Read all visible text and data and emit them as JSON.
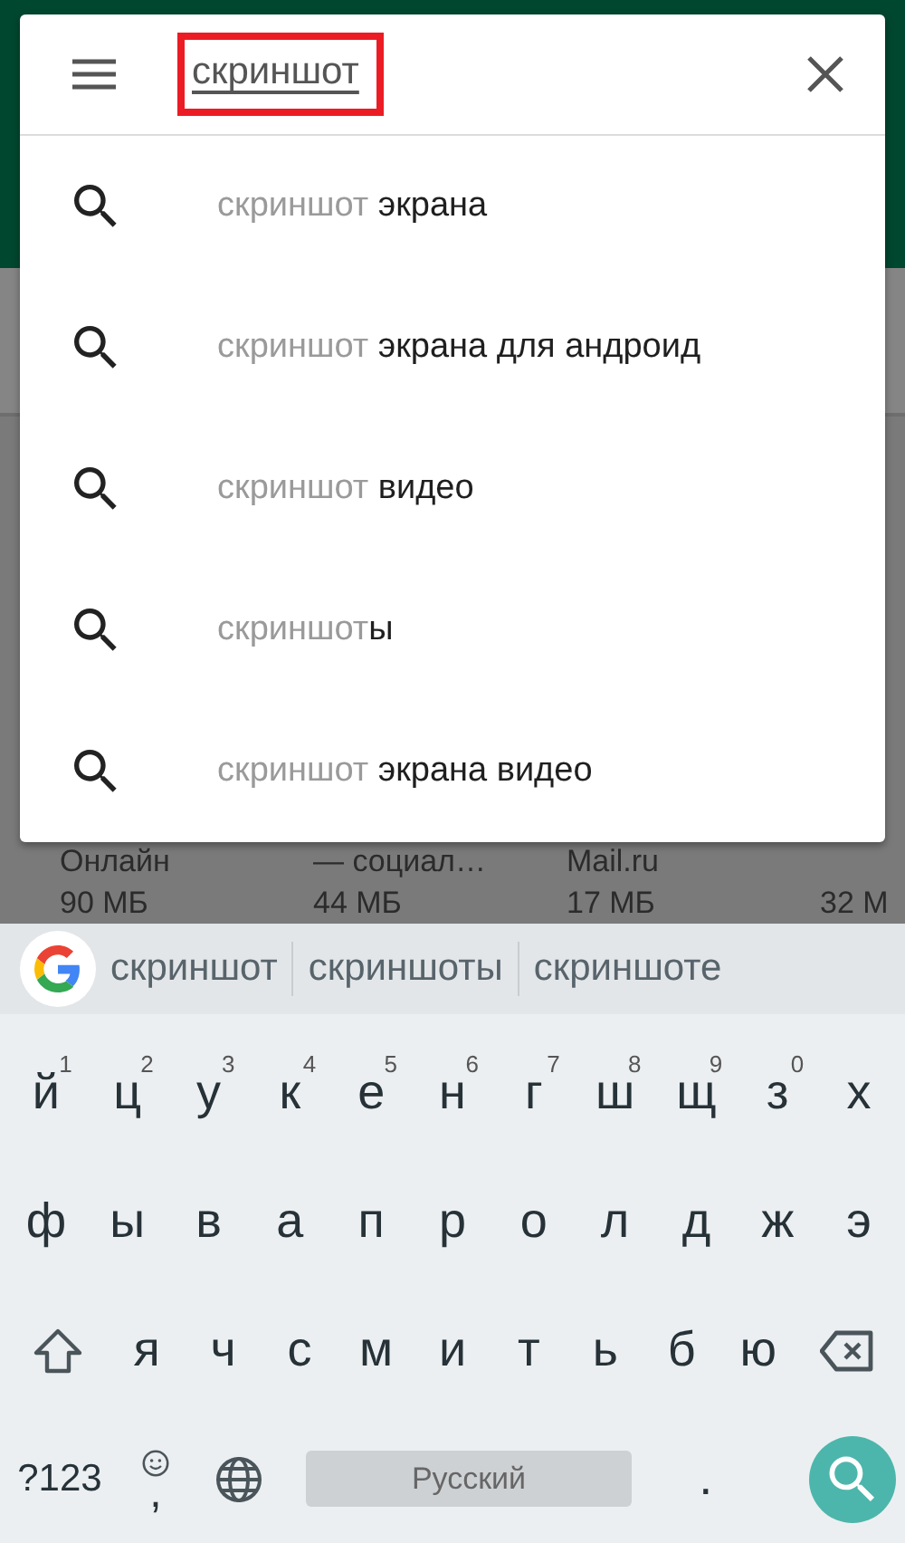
{
  "search": {
    "value": "скриншот",
    "highlighted": true
  },
  "suggestions": [
    {
      "typed": "скриншот",
      "completion": " экрана"
    },
    {
      "typed": "скриншот",
      "completion": " экрана для андроид"
    },
    {
      "typed": "скриншот",
      "completion": " видео"
    },
    {
      "typed": "скриншот",
      "completion": "ы"
    },
    {
      "typed": "скриншот",
      "completion": " экрана видео"
    }
  ],
  "apps": [
    {
      "name": "Онлайн",
      "size": "90 МБ"
    },
    {
      "name": "— социал…",
      "size": "44 МБ"
    },
    {
      "name": "Mail.ru",
      "size": "17 МБ"
    },
    {
      "size": "32 М"
    }
  ],
  "keyboard": {
    "word_suggestions": [
      "скриншот",
      "скриншоты",
      "скриншоте"
    ],
    "rows": [
      {
        "keys": [
          {
            "kind": "letter",
            "label": "й",
            "hint": "1"
          },
          {
            "kind": "letter",
            "label": "ц",
            "hint": "2"
          },
          {
            "kind": "letter",
            "label": "у",
            "hint": "3"
          },
          {
            "kind": "letter",
            "label": "к",
            "hint": "4"
          },
          {
            "kind": "letter",
            "label": "е",
            "hint": "5"
          },
          {
            "kind": "letter",
            "label": "н",
            "hint": "6"
          },
          {
            "kind": "letter",
            "label": "г",
            "hint": "7"
          },
          {
            "kind": "letter",
            "label": "ш",
            "hint": "8"
          },
          {
            "kind": "letter",
            "label": "щ",
            "hint": "9"
          },
          {
            "kind": "letter",
            "label": "з",
            "hint": "0"
          },
          {
            "kind": "letter",
            "label": "х"
          }
        ]
      },
      {
        "keys": [
          {
            "kind": "letter",
            "label": "ф"
          },
          {
            "kind": "letter",
            "label": "ы"
          },
          {
            "kind": "letter",
            "label": "в"
          },
          {
            "kind": "letter",
            "label": "а"
          },
          {
            "kind": "letter",
            "label": "п"
          },
          {
            "kind": "letter",
            "label": "р"
          },
          {
            "kind": "letter",
            "label": "о"
          },
          {
            "kind": "letter",
            "label": "л"
          },
          {
            "kind": "letter",
            "label": "д"
          },
          {
            "kind": "letter",
            "label": "ж"
          },
          {
            "kind": "letter",
            "label": "э"
          }
        ]
      },
      {
        "keys": [
          {
            "kind": "shift"
          },
          {
            "kind": "letter",
            "label": "я"
          },
          {
            "kind": "letter",
            "label": "ч"
          },
          {
            "kind": "letter",
            "label": "с"
          },
          {
            "kind": "letter",
            "label": "м"
          },
          {
            "kind": "letter",
            "label": "и"
          },
          {
            "kind": "letter",
            "label": "т"
          },
          {
            "kind": "letter",
            "label": "ь"
          },
          {
            "kind": "letter",
            "label": "б"
          },
          {
            "kind": "letter",
            "label": "ю"
          },
          {
            "kind": "backspace"
          }
        ]
      },
      {
        "keys": [
          {
            "kind": "symbols",
            "label": "?123"
          },
          {
            "kind": "comma",
            "label": ","
          },
          {
            "kind": "globe"
          },
          {
            "kind": "space",
            "label": "Русский"
          },
          {
            "kind": "period",
            "label": "."
          },
          {
            "kind": "action"
          }
        ]
      }
    ]
  }
}
